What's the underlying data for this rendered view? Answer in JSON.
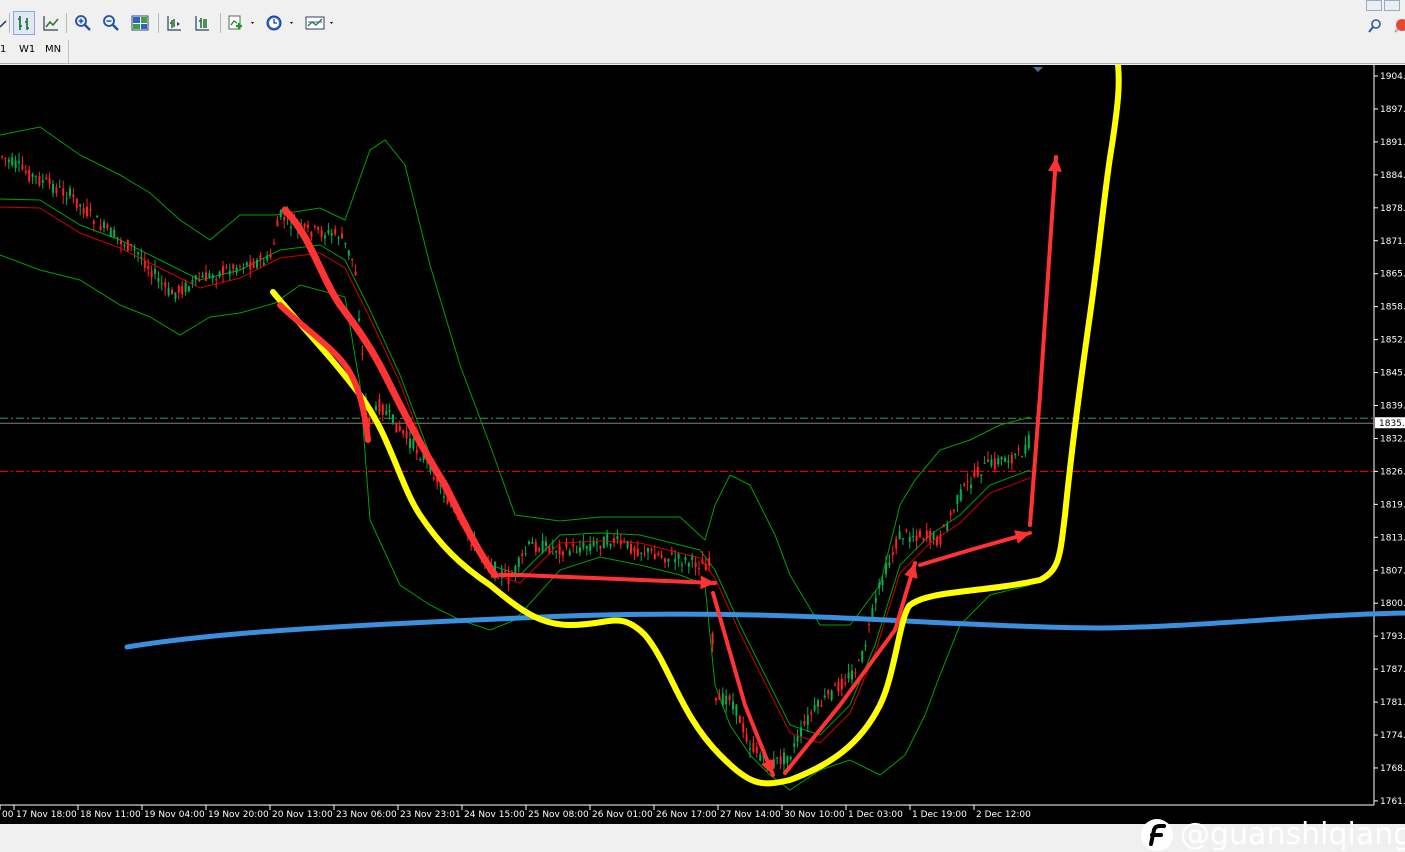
{
  "toolbar": {
    "buttons": [
      {
        "name": "line-chart-button-partial",
        "icon": "chart-line-icon"
      },
      {
        "name": "bar-chart-button",
        "icon": "bar-chart-icon"
      },
      {
        "name": "candlestick-button",
        "icon": "candlestick-icon"
      },
      {
        "name": "zoom-in-button",
        "icon": "zoom-in-icon"
      },
      {
        "name": "zoom-out-button",
        "icon": "zoom-out-icon"
      },
      {
        "name": "tile-windows-button",
        "icon": "tile-windows-icon"
      },
      {
        "name": "chart-shift-button",
        "icon": "chart-shift-icon"
      },
      {
        "name": "auto-scroll-button",
        "icon": "auto-scroll-icon"
      },
      {
        "name": "indicators-button",
        "icon": "indicators-icon"
      },
      {
        "name": "periods-button",
        "icon": "clock-icon"
      },
      {
        "name": "templates-button",
        "icon": "templates-icon"
      }
    ],
    "right_icons": [
      "search-icon",
      "chat-bubble-icon"
    ]
  },
  "timeframes": [
    "1",
    "W1",
    "MN"
  ],
  "chart_data": {
    "type": "candlestick",
    "y_ticks": [
      "1904.",
      "1897.",
      "1891.",
      "1884.",
      "1878.",
      "1871.",
      "1865.",
      "1858.",
      "1852.",
      "1845.",
      "1839.",
      "1832.",
      "1826.",
      "1819.",
      "1813.",
      "1807.",
      "1800.",
      "1793.",
      "1787.",
      "1781.",
      "1774.",
      "1768.",
      "1761."
    ],
    "x_ticks": [
      "00",
      "17 Nov 18:00",
      "18 Nov 11:00",
      "19 Nov 04:00",
      "19 Nov 20:00",
      "20 Nov 13:00",
      "23 Nov 06:00",
      "23 Nov 23:01",
      "24 Nov 15:00",
      "25 Nov 08:00",
      "26 Nov 01:00",
      "26 Nov 17:00",
      "27 Nov 14:00",
      "30 Nov 10:00",
      "1 Dec 03:00",
      "1 Dec 19:00",
      "2 Dec 12:00"
    ],
    "current_price_label": "1835.",
    "ylim": [
      1761,
      1904
    ],
    "grid": false,
    "colors": {
      "bull": "#00b050",
      "bear": "#ff2020",
      "bands": "#00a000",
      "ma": "#ff0000",
      "price_line": "#808080",
      "level_line": "#ff0000",
      "yellow_annotation": "#ffff00",
      "blue_annotation": "#3a8fde",
      "red_arrows": "#ff3333"
    }
  },
  "watermark": {
    "text": "@guanshiqiang",
    "icon": "brand-logo-icon"
  }
}
